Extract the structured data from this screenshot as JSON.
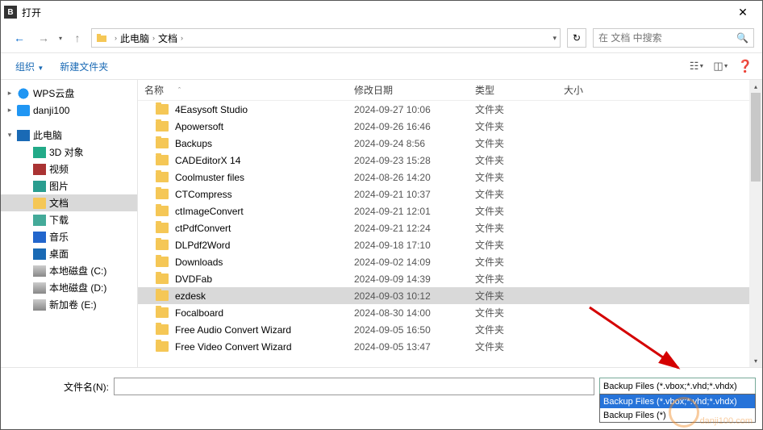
{
  "title": "打开",
  "path": {
    "crumbs": [
      "此电脑",
      "文档"
    ]
  },
  "search": {
    "placeholder": "在 文档 中搜索"
  },
  "toolbar": {
    "organize": "组织",
    "newfolder": "新建文件夹"
  },
  "sidebar": [
    {
      "label": "WPS云盘",
      "icon": "ico-cloud",
      "indent": 0
    },
    {
      "label": "danji100",
      "icon": "ico-blue",
      "indent": 0,
      "spacer_after": true
    },
    {
      "label": "此电脑",
      "icon": "ico-pc",
      "indent": 0,
      "expand": "▾"
    },
    {
      "label": "3D 对象",
      "icon": "ico-3d",
      "indent": 1
    },
    {
      "label": "视频",
      "icon": "ico-vid",
      "indent": 1
    },
    {
      "label": "图片",
      "icon": "ico-pic",
      "indent": 1
    },
    {
      "label": "文档",
      "icon": "ico-folder",
      "indent": 1,
      "selected": true
    },
    {
      "label": "下载",
      "icon": "ico-down",
      "indent": 1
    },
    {
      "label": "音乐",
      "icon": "ico-music",
      "indent": 1
    },
    {
      "label": "桌面",
      "icon": "ico-desk",
      "indent": 1
    },
    {
      "label": "本地磁盘 (C:)",
      "icon": "ico-disk",
      "indent": 1
    },
    {
      "label": "本地磁盘 (D:)",
      "icon": "ico-disk",
      "indent": 1
    },
    {
      "label": "新加卷 (E:)",
      "icon": "ico-disk",
      "indent": 1
    }
  ],
  "columns": {
    "name": "名称",
    "date": "修改日期",
    "type": "类型",
    "size": "大小"
  },
  "files": [
    {
      "name": "4Easysoft Studio",
      "date": "2024-09-27 10:06",
      "type": "文件夹"
    },
    {
      "name": "Apowersoft",
      "date": "2024-09-26 16:46",
      "type": "文件夹"
    },
    {
      "name": "Backups",
      "date": "2024-09-24 8:56",
      "type": "文件夹"
    },
    {
      "name": "CADEditorX 14",
      "date": "2024-09-23 15:28",
      "type": "文件夹"
    },
    {
      "name": "Coolmuster files",
      "date": "2024-08-26 14:20",
      "type": "文件夹"
    },
    {
      "name": "CTCompress",
      "date": "2024-09-21 10:37",
      "type": "文件夹"
    },
    {
      "name": "ctImageConvert",
      "date": "2024-09-21 12:01",
      "type": "文件夹"
    },
    {
      "name": "ctPdfConvert",
      "date": "2024-09-21 12:24",
      "type": "文件夹"
    },
    {
      "name": "DLPdf2Word",
      "date": "2024-09-18 17:10",
      "type": "文件夹"
    },
    {
      "name": "Downloads",
      "date": "2024-09-02 14:09",
      "type": "文件夹"
    },
    {
      "name": "DVDFab",
      "date": "2024-09-09 14:39",
      "type": "文件夹"
    },
    {
      "name": "ezdesk",
      "date": "2024-09-03 10:12",
      "type": "文件夹",
      "selected": true
    },
    {
      "name": "Focalboard",
      "date": "2024-08-30 14:00",
      "type": "文件夹"
    },
    {
      "name": "Free Audio Convert Wizard",
      "date": "2024-09-05 16:50",
      "type": "文件夹"
    },
    {
      "name": "Free Video Convert Wizard",
      "date": "2024-09-05 13:47",
      "type": "文件夹"
    }
  ],
  "filename_label": "文件名(N):",
  "filename_value": "",
  "filter": {
    "label": "Backup Files (*.vbox;*.vhd;*.vhdx)",
    "options": [
      "Backup Files (*.vbox;*.vhd;*.vhdx)",
      "Backup Files (*)"
    ]
  },
  "watermark": "danji100.com"
}
